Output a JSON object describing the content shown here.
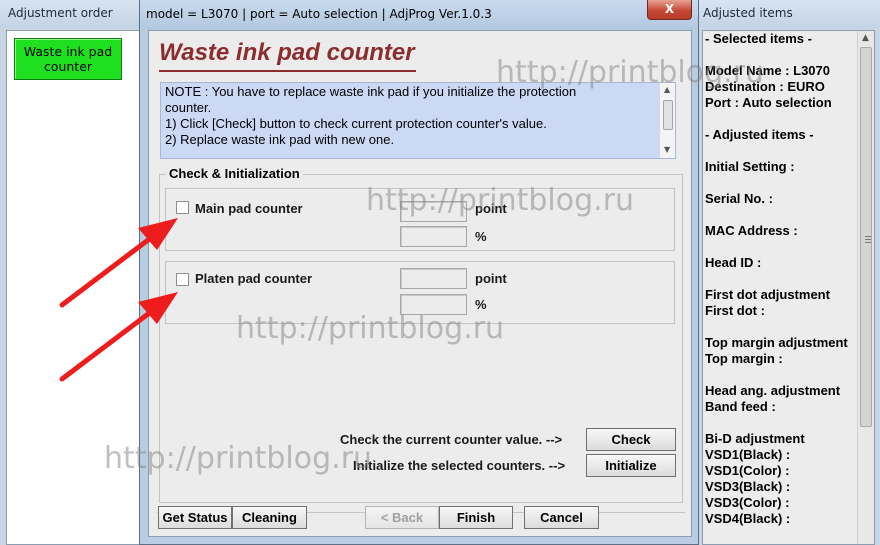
{
  "left_window": {
    "title": "Adjustment order",
    "menu_item": "Waste ink pad\ncounter"
  },
  "main_window": {
    "title": "model = L3070 | port = Auto selection | AdjProg Ver.1.0.3",
    "close_glyph": "X",
    "heading": "Waste ink pad counter",
    "note_lines": [
      "NOTE : You have to replace waste ink pad if you initialize the protection",
      "counter.",
      "1) Click [Check] button to check current protection counter's value.",
      "2) Replace waste ink pad with new one."
    ],
    "group_title": "Check & Initialization",
    "main_pad": {
      "label": "Main pad counter",
      "unit_point": "point",
      "unit_percent": "%"
    },
    "platen_pad": {
      "label": "Platen pad counter",
      "unit_point": "point",
      "unit_percent": "%"
    },
    "check_prompt": "Check the current counter value.  -->",
    "check_button": "Check",
    "init_prompt": "Initialize the selected counters.  -->",
    "init_button": "Initialize",
    "bottom_buttons": {
      "get_status": "Get Status",
      "cleaning": "Cleaning",
      "back": "< Back",
      "finish": "Finish",
      "cancel": "Cancel"
    }
  },
  "right_window": {
    "title": "Adjusted items",
    "lines": [
      " - Selected items -",
      "Model Name : L3070",
      "Destination : EURO",
      "Port : Auto selection",
      " - Adjusted items -",
      "Initial Setting :",
      "Serial No. :",
      "MAC Address :",
      "Head ID :",
      "First dot adjustment",
      " First dot :",
      "Top margin adjustment",
      " Top margin :",
      "Head ang. adjustment",
      " Band feed :",
      "Bi-D adjustment",
      " VSD1(Black) :",
      " VSD1(Color) :",
      " VSD3(Black) :",
      " VSD3(Color) :",
      " VSD4(Black) :"
    ]
  },
  "watermark": "http://printblog.ru",
  "colors": {
    "menu_item_bg": "#1fe01f",
    "heading": "#8b2d2d",
    "note_bg": "#cbd9f5",
    "annotation_arrow": "#ee1c1c",
    "close_button": "#c54a36"
  }
}
